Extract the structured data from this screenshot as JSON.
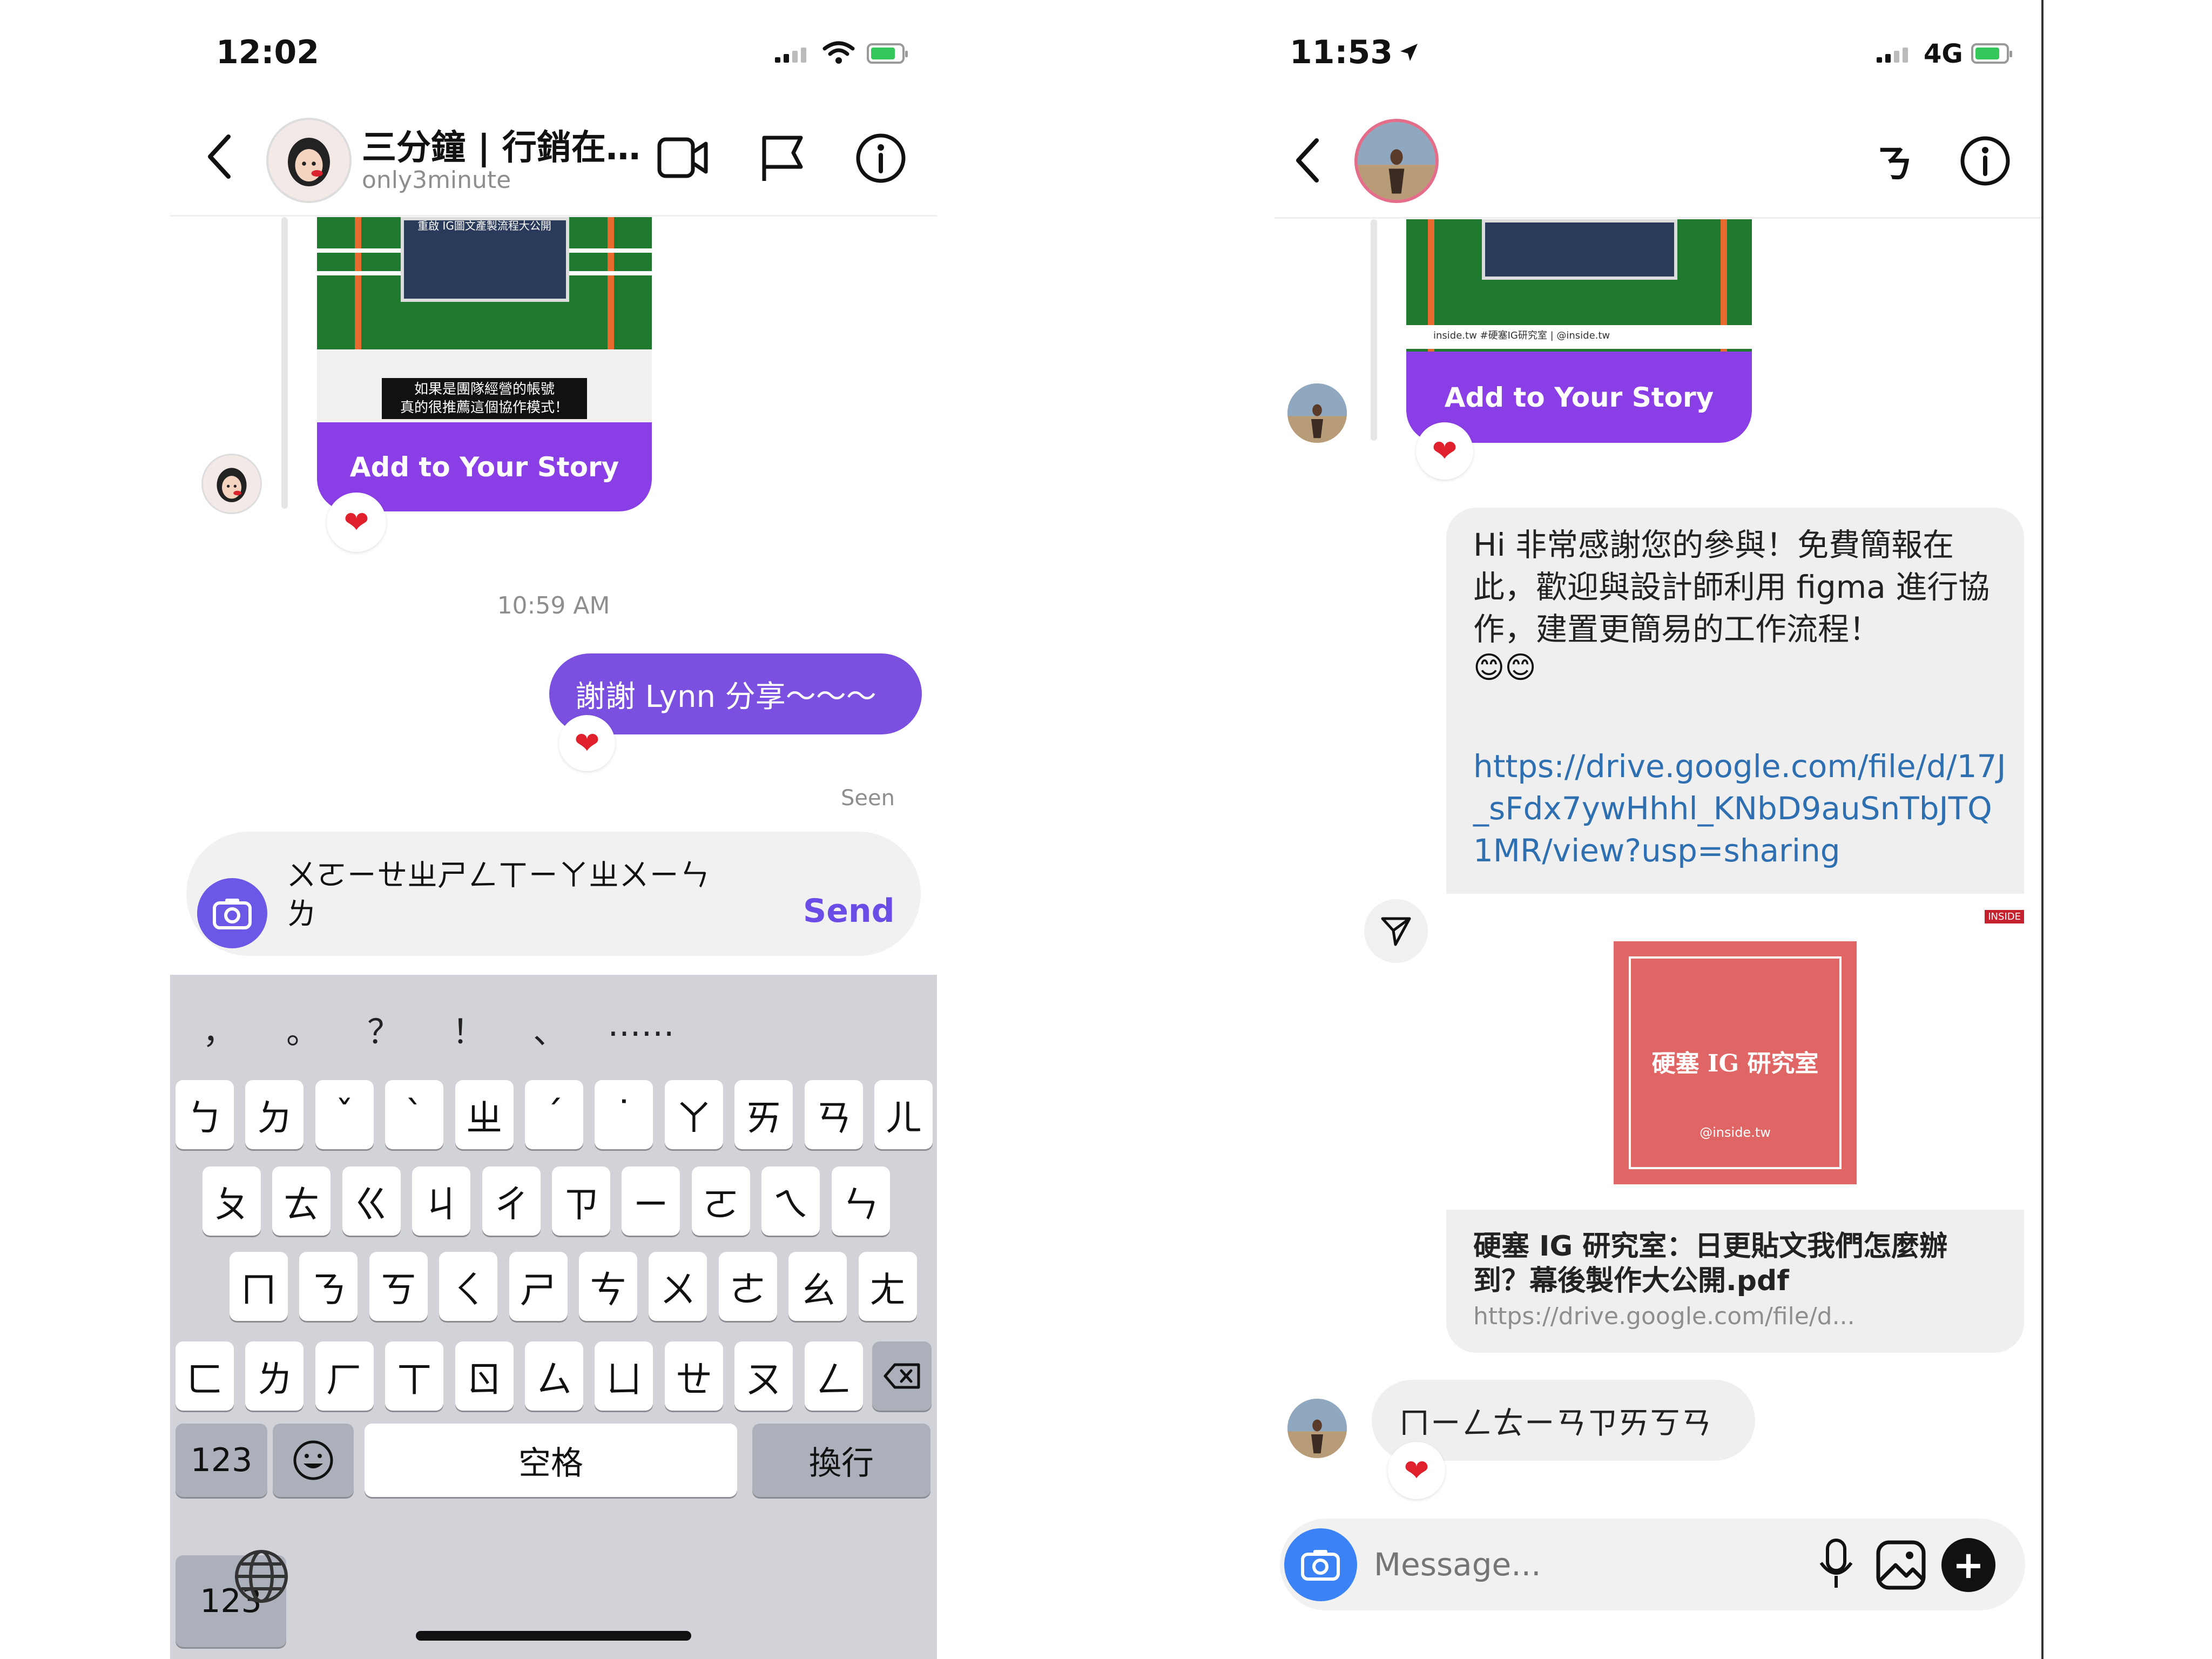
{
  "left": {
    "status": {
      "time": "12:02"
    },
    "header": {
      "title": "三分鐘 | 行銷在…",
      "subtitle": "only3minute"
    },
    "story": {
      "banner": "重啟 IG圖文產製流程大公開",
      "caption_line1": "如果是團隊經營的帳號",
      "caption_line2": "真的很推薦這個協作模式！",
      "add_label": "Add to Your Story"
    },
    "timestamp": "10:59 AM",
    "sent_message": "謝謝 Lynn 分享～～～",
    "seen": "Seen",
    "composer": {
      "text_line1": "ㄨㄛㄧㄝㄓㄕㄥㄒㄧㄚㄓㄨㄧㄣ",
      "text_line2": "ㄌ",
      "send_label": "Send"
    },
    "keyboard": {
      "punctuation": [
        "，",
        "。",
        "？",
        "！",
        "、",
        "……"
      ],
      "row1": [
        "ㄅ",
        "ㄉ",
        "ˇ",
        "ˋ",
        "ㄓ",
        "ˊ",
        "˙",
        "ㄚ",
        "ㄞ",
        "ㄢ",
        "ㄦ"
      ],
      "row2": [
        "ㄆ",
        "ㄊ",
        "ㄍ",
        "ㄐ",
        "ㄔ",
        "ㄗ",
        "ㄧ",
        "ㄛ",
        "ㄟ",
        "ㄣ"
      ],
      "row3": [
        "ㄇ",
        "ㄋ",
        "ㄎ",
        "ㄑ",
        "ㄕ",
        "ㄘ",
        "ㄨ",
        "ㄜ",
        "ㄠ",
        "ㄤ"
      ],
      "row4": [
        "ㄈ",
        "ㄌ",
        "ㄏ",
        "ㄒ",
        "ㄖ",
        "ㄙ",
        "ㄩ",
        "ㄝ",
        "ㄡ",
        "ㄥ"
      ],
      "numbers_label": "123",
      "space_label": "空格",
      "return_label": "換行"
    }
  },
  "right": {
    "status": {
      "time": "11:53",
      "network": "4G"
    },
    "header": {
      "title_glyph": "ㄋ"
    },
    "story": {
      "watermark": "inside.tw #硬塞IG研究室 | @inside.tw",
      "add_label": "Add to Your Story"
    },
    "message": {
      "text": "Hi 非常感謝您的參與！免費簡報在此，歡迎與設計師利用 figma 進行協作，建置更簡易的工作流程！",
      "emoji": "😊😊",
      "link": "https://drive.google.com/file/d/17J_sFdx7ywHhhl_KNbD9auSnTbJTQ1MR/view?usp=sharing"
    },
    "preview": {
      "brand": "INSIDE",
      "cover_title": "硬塞 IG 研究室",
      "cover_handle": "@inside.tw",
      "title": "硬塞 IG 研究室：日更貼文我們怎麼辦到？幕後製作大公開.pdf",
      "url": "https://drive.google.com/file/d..."
    },
    "received_message": "ㄇㄧㄥㄊㄧㄢㄗㄞㄎㄢ",
    "composer": {
      "placeholder": "Message..."
    }
  },
  "colors": {
    "purple": "#8a3ee6",
    "send": "#6b4ce6",
    "link": "#2d6fb0",
    "camera": "#3b82f6"
  }
}
